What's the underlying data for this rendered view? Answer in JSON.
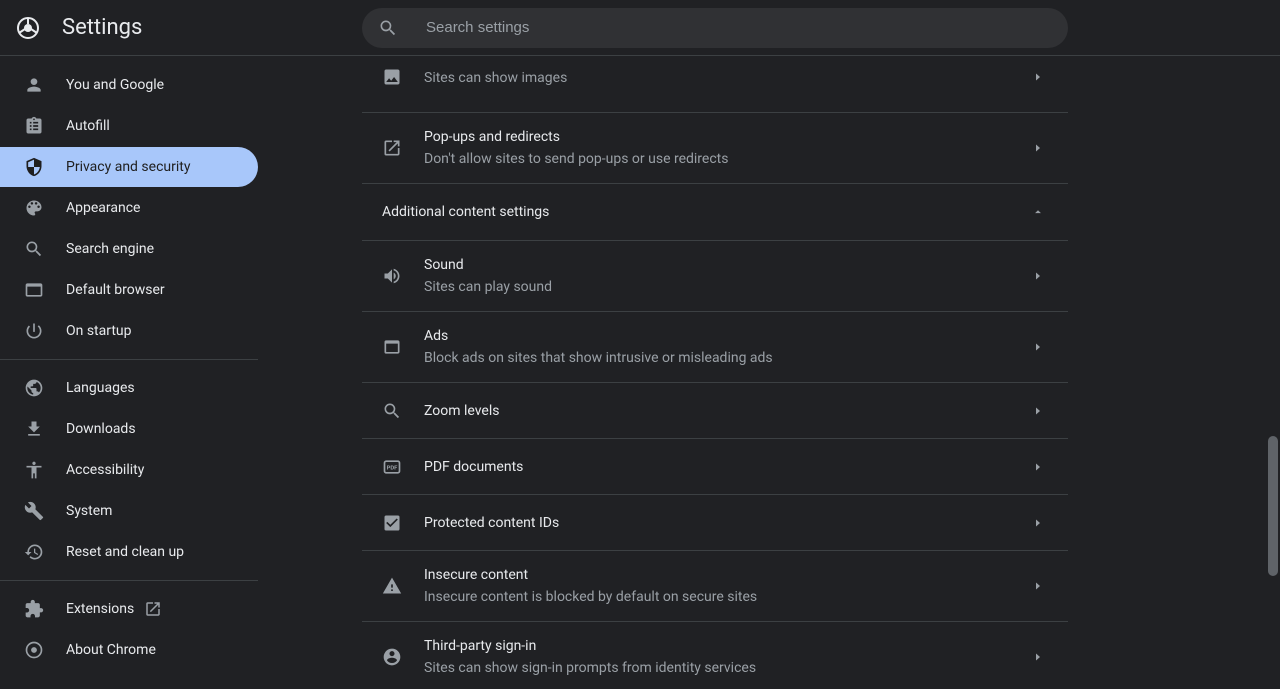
{
  "header": {
    "title": "Settings"
  },
  "search": {
    "placeholder": "Search settings"
  },
  "sidebar": {
    "groups": [
      [
        {
          "icon": "person",
          "label": "You and Google",
          "active": false
        },
        {
          "icon": "clipboard",
          "label": "Autofill",
          "active": false
        },
        {
          "icon": "shield",
          "label": "Privacy and security",
          "active": true
        },
        {
          "icon": "palette",
          "label": "Appearance",
          "active": false
        },
        {
          "icon": "search",
          "label": "Search engine",
          "active": false
        },
        {
          "icon": "browser",
          "label": "Default browser",
          "active": false
        },
        {
          "icon": "power",
          "label": "On startup",
          "active": false
        }
      ],
      [
        {
          "icon": "globe",
          "label": "Languages",
          "active": false
        },
        {
          "icon": "download",
          "label": "Downloads",
          "active": false
        },
        {
          "icon": "accessibility",
          "label": "Accessibility",
          "active": false
        },
        {
          "icon": "wrench",
          "label": "System",
          "active": false
        },
        {
          "icon": "history",
          "label": "Reset and clean up",
          "active": false
        }
      ],
      [
        {
          "icon": "puzzle",
          "label": "Extensions",
          "active": false,
          "external": true
        },
        {
          "icon": "chrome",
          "label": "About Chrome",
          "active": false
        }
      ]
    ]
  },
  "content": {
    "partial_row": {
      "sub": "Sites can show images"
    },
    "popups": {
      "title": "Pop-ups and redirects",
      "sub": "Don't allow sites to send pop-ups or use redirects"
    },
    "section_header": "Additional content settings",
    "rows": [
      {
        "icon": "volume",
        "title": "Sound",
        "sub": "Sites can play sound"
      },
      {
        "icon": "window",
        "title": "Ads",
        "sub": "Block ads on sites that show intrusive or misleading ads"
      },
      {
        "icon": "search",
        "title": "Zoom levels",
        "sub": ""
      },
      {
        "icon": "pdf",
        "title": "PDF documents",
        "sub": ""
      },
      {
        "icon": "checkbox",
        "title": "Protected content IDs",
        "sub": ""
      },
      {
        "icon": "warning",
        "title": "Insecure content",
        "sub": "Insecure content is blocked by default on secure sites"
      },
      {
        "icon": "account",
        "title": "Third-party sign-in",
        "sub": "Sites can show sign-in prompts from identity services"
      }
    ]
  }
}
